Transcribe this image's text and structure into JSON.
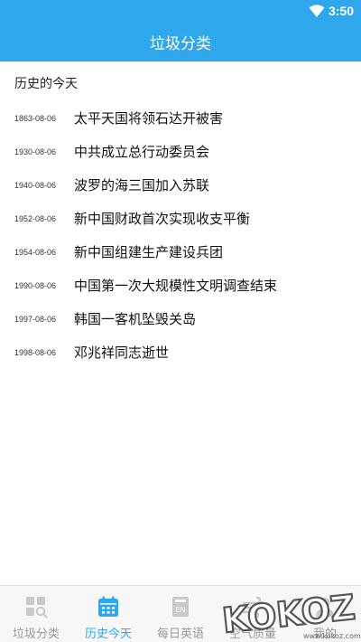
{
  "status_bar": {
    "time": "3:50"
  },
  "app_bar": {
    "title": "垃圾分类"
  },
  "section": {
    "title": "历史的今天"
  },
  "events": [
    {
      "date": "1863-08-06",
      "title": "太平天国将领石达开被害"
    },
    {
      "date": "1930-08-06",
      "title": "中共成立总行动委员会"
    },
    {
      "date": "1940-08-06",
      "title": "波罗的海三国加入苏联"
    },
    {
      "date": "1952-08-06",
      "title": "新中国财政首次实现收支平衡"
    },
    {
      "date": "1954-08-06",
      "title": "新中国组建生产建设兵团"
    },
    {
      "date": "1990-08-06",
      "title": "中国第一次大规模性文明调查结束"
    },
    {
      "date": "1997-08-06",
      "title": "韩国一客机坠毁关岛"
    },
    {
      "date": "1998-08-06",
      "title": "邓兆祥同志逝世"
    }
  ],
  "bottom_nav": [
    {
      "label": "垃圾分类",
      "icon": "grid-search-icon",
      "active": false
    },
    {
      "label": "历史今天",
      "icon": "calendar-icon",
      "active": true
    },
    {
      "label": "每日英语",
      "icon": "english-book-icon",
      "active": false
    },
    {
      "label": "空气质量",
      "icon": "air-quality-icon",
      "active": false
    },
    {
      "label": "我的",
      "icon": "profile-icon",
      "active": false
    }
  ],
  "watermark": {
    "text": "KOKOZ",
    "subtext": "www.kokoz.com"
  },
  "colors": {
    "accent": "#2ea7ec",
    "nav_inactive": "#9a9a9a"
  }
}
